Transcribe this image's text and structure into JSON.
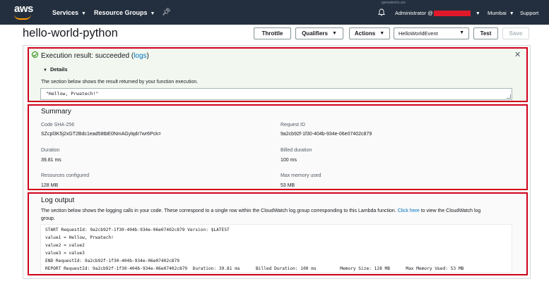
{
  "nav": {
    "logo": "aws",
    "services": "Services",
    "resource_groups": "Resource Groups",
    "admin_label": "Administrator @",
    "region": "Mumbai",
    "support": "Support",
    "watermark": "garwatechs.ars"
  },
  "header": {
    "function_name": "hello-world-python",
    "throttle": "Throttle",
    "qualifiers": "Qualifiers",
    "actions": "Actions",
    "test_event": "HelloWorldEvent",
    "test": "Test",
    "save": "Save"
  },
  "execution": {
    "title_prefix": "Execution result: succeeded (",
    "logs_link": "logs",
    "title_suffix": ")",
    "details": "Details",
    "description": "The section below shows the result returned by your function execution.",
    "result": "\"Hellow, Prwatech!\""
  },
  "summary": {
    "title": "Summary",
    "code_sha_label": "Code SHA-256",
    "code_sha_value": "SZcpl3K5j2xGT2Bdc1ead58tbE0NmAGylqdr7wr6Pck=",
    "request_id_label": "Request ID",
    "request_id_value": "9a2cb92f-1f30-404b-934e-06e07402c879",
    "duration_label": "Duration",
    "duration_value": "39.81 ms",
    "billed_label": "Billed duration",
    "billed_value": "100 ms",
    "resources_label": "Resources configured",
    "resources_value": "128 MB",
    "max_memory_label": "Max memory used",
    "max_memory_value": "53 MB"
  },
  "log": {
    "title": "Log output",
    "desc_before": "The section below shows the logging calls in your code. These correspond to a single row within the CloudWatch log group corresponding to this Lambda function. ",
    "click_here": "Click here",
    "desc_after": " to view the CloudWatch log group.",
    "lines": [
      "START RequestId: 9a2cb92f-1f30-404b-934e-06e07402c879 Version: $LATEST",
      "value1 = Hellow, Prwatech!",
      "value2 = value2",
      "value3 = value3",
      "END RequestId: 9a2cb92f-1f30-404b-934e-06e07402c879",
      "REPORT RequestId: 9a2cb92f-1f30-404b-934e-06e07402c879  Duration: 39.81 ms      Billed Duration: 100 ms         Memory Size: 128 MB      Max Memory Used: 53 MB"
    ]
  },
  "colors": {
    "nav_bg": "#232f3e",
    "highlight_red": "#d0021b",
    "success_green": "#1d8102",
    "link_blue": "#0073bb"
  }
}
